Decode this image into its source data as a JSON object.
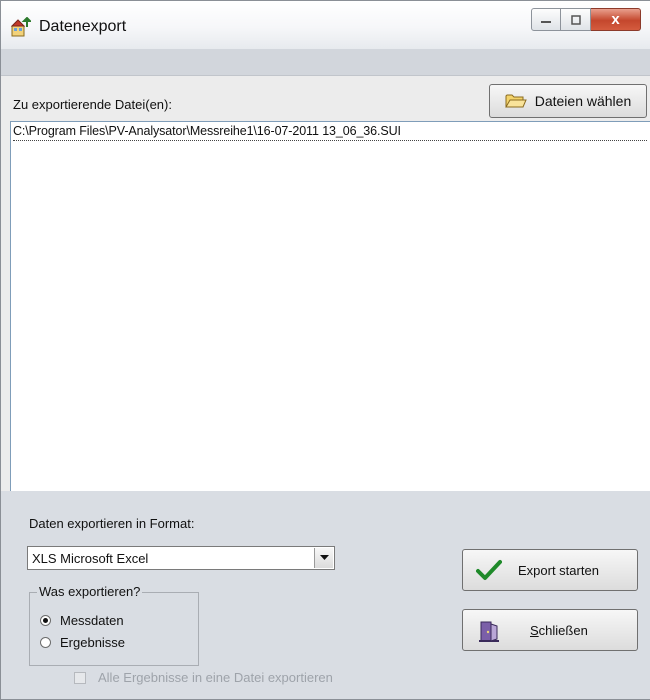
{
  "window": {
    "title": "Datenexport",
    "close_glyph": "x"
  },
  "files": {
    "label": "Zu exportierende Datei(en):",
    "choose_button": "Dateien wählen",
    "items": [
      "C:\\Program Files\\PV-Analysator\\Messreihe1\\16-07-2011  13_06_36.SUI"
    ]
  },
  "format": {
    "label": "Daten exportieren in Format:",
    "selected": "XLS Microsoft Excel"
  },
  "what": {
    "legend": "Was exportieren?",
    "options": [
      {
        "label": "Messdaten",
        "checked": true
      },
      {
        "label": "Ergebnisse",
        "checked": false
      }
    ]
  },
  "all_results": {
    "label": "Alle Ergebnisse in eine Datei exportieren",
    "checked": false,
    "enabled": false
  },
  "actions": {
    "export_label": "Export starten",
    "close_label_u": "S",
    "close_label_rest": "chließen"
  },
  "icons": {
    "app": "app-icon",
    "folder": "folder-icon",
    "export": "checkmark-icon",
    "close": "exit-door-icon"
  },
  "colors": {
    "window_bg": "#d9dde3",
    "close_button": "#c4472d",
    "checkmark": "#1f8a2a"
  }
}
